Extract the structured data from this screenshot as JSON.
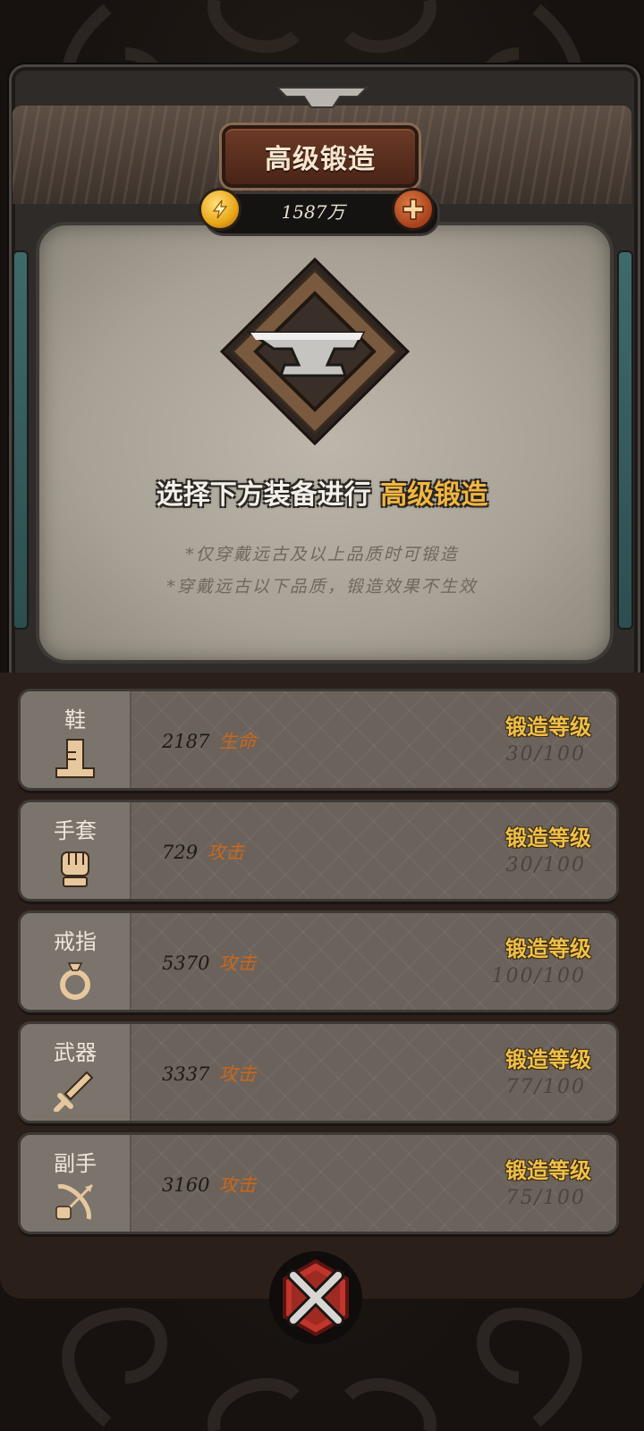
{
  "header": {
    "title": "高级锻造",
    "currency": "1587万",
    "coin_icon": "lightning-coin-icon",
    "add_icon": "plus-icon"
  },
  "main": {
    "instruction_prefix": "选择下方装备进行",
    "instruction_highlight": "高级锻造",
    "notes": [
      "*仅穿戴远古及以上品质时可锻造",
      "*穿戴远古以下品质，锻造效果不生效"
    ],
    "emblem_icon": "anvil-icon"
  },
  "slots": [
    {
      "name": "鞋",
      "icon": "boot-icon",
      "stat_value": "2187",
      "stat_label": "生命",
      "level_label": "锻造等级",
      "level": "30/100"
    },
    {
      "name": "手套",
      "icon": "fist-icon",
      "stat_value": "729",
      "stat_label": "攻击",
      "level_label": "锻造等级",
      "level": "30/100"
    },
    {
      "name": "戒指",
      "icon": "ring-icon",
      "stat_value": "5370",
      "stat_label": "攻击",
      "level_label": "锻造等级",
      "level": "100/100"
    },
    {
      "name": "武器",
      "icon": "sword-icon",
      "stat_value": "3337",
      "stat_label": "攻击",
      "level_label": "锻造等级",
      "level": "77/100"
    },
    {
      "name": "副手",
      "icon": "bow-icon",
      "stat_value": "3160",
      "stat_label": "攻击",
      "level_label": "锻造等级",
      "level": "75/100"
    }
  ],
  "footer": {
    "close_icon": "close-x-icon"
  },
  "colors": {
    "accent_gold": "#f2b640",
    "stat_orange": "#c9671d",
    "title_plate": "#6b3b26",
    "close_red": "#c0352c"
  }
}
